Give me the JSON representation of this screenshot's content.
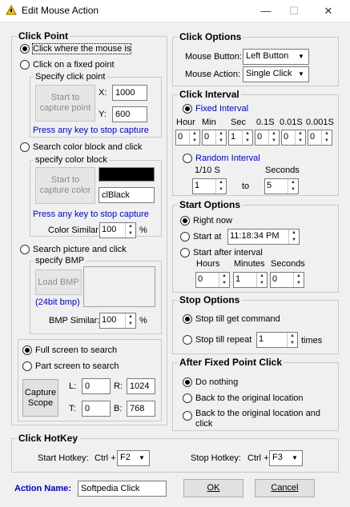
{
  "window": {
    "title": "Edit Mouse Action",
    "minimize": "—",
    "maximize": "☐",
    "close": "✕"
  },
  "click_point": {
    "title": "Click Point",
    "opt_click_mouse": "Click where the mouse is",
    "opt_fixed": "Click on a fixed point",
    "specify_click_point": "Specify click point",
    "start_capture_point": "Start to capture point",
    "x_label": "X:",
    "x_value": "1000",
    "y_label": "Y:",
    "y_value": "600",
    "stop_hint_1": "Press any key to stop capture",
    "opt_color": "Search color block and click",
    "specify_color_block": "specify color block",
    "start_capture_color": "Start to capture color",
    "color_name": "clBlack",
    "stop_hint_2": "Press any key to stop capture",
    "color_similar_label": "Color Similar:",
    "color_similar_value": "100",
    "percent_1": "%",
    "opt_picture": "Search picture and click",
    "specify_bmp": "specify BMP",
    "load_bmp": "Load BMP",
    "bmp_bits": "(24bit bmp)",
    "bmp_similar_label": "BMP Similar:",
    "bmp_similar_value": "100",
    "percent_2": "%",
    "opt_full_screen": "Full screen to search",
    "opt_part_screen": "Part screen to search",
    "capture_scope": "Capture Scope",
    "l_label": "L:",
    "l_value": "0",
    "r_label": "R:",
    "r_value": "1024",
    "t_label": "T:",
    "t_value": "0",
    "b_label": "B:",
    "b_value": "768"
  },
  "click_options": {
    "title": "Click Options",
    "mouse_button_label": "Mouse Button:",
    "mouse_button_value": "Left Button",
    "mouse_action_label": "Mouse Action:",
    "mouse_action_value": "Single Click"
  },
  "click_interval": {
    "title": "Click Interval",
    "opt_fixed": "Fixed Interval",
    "headers": [
      "Hour",
      "Min",
      "Sec",
      "0.1S",
      "0.01S",
      "0.001S"
    ],
    "values": [
      "0",
      "0",
      "1",
      "0",
      "0",
      "0"
    ],
    "opt_random": "Random Interval",
    "tenth_label": "1/10 S",
    "seconds_label": "Seconds",
    "from_value": "1",
    "to_label": "to",
    "to_value": "5"
  },
  "start_options": {
    "title": "Start Options",
    "opt_now": "Right now",
    "opt_at": "Start at",
    "at_value": "11:18:34 PM",
    "opt_after": "Start after interval",
    "hours_label": "Hours",
    "minutes_label": "Minutes",
    "seconds_label": "Seconds",
    "hours_value": "0",
    "minutes_value": "1",
    "seconds_value": "0"
  },
  "stop_options": {
    "title": "Stop Options",
    "opt_command": "Stop till get command",
    "opt_repeat": "Stop till repeat",
    "repeat_value": "1",
    "times_label": "times"
  },
  "after_fixed": {
    "title": "After Fixed Point Click",
    "opt_nothing": "Do nothing",
    "opt_back": "Back to the original location",
    "opt_back_click": "Back to the original location and click"
  },
  "hotkey": {
    "title": "Click HotKey",
    "start_label": "Start Hotkey:",
    "start_mod": "Ctrl +",
    "start_key": "F2",
    "stop_label": "Stop Hotkey:",
    "stop_mod": "Ctrl +",
    "stop_key": "F3"
  },
  "footer": {
    "action_name_label": "Action Name:",
    "action_name_value": "Softpedia Click",
    "ok": "OK",
    "cancel": "Cancel"
  },
  "colors": {
    "blue_text": "#0000cc",
    "selected_color": "#000000"
  }
}
